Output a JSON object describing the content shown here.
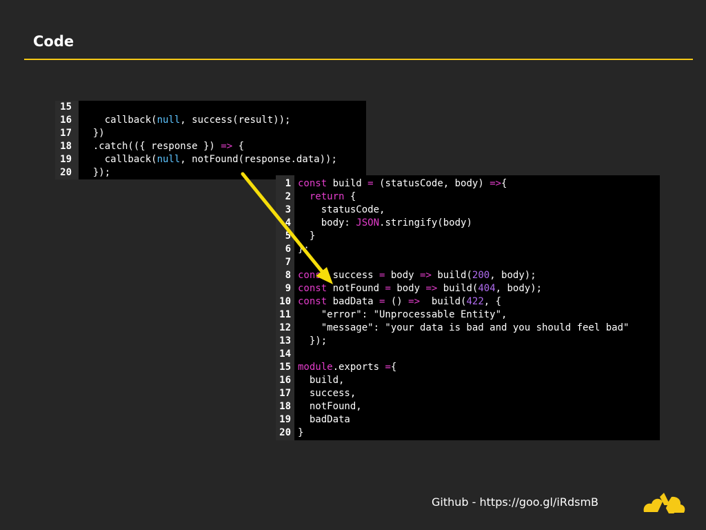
{
  "slide": {
    "title": "Code",
    "footer_link": "Github - https://goo.gl/iRdsmB"
  },
  "colors": {
    "background": "#262626",
    "accent": "#f6c915",
    "code_bg": "#000000",
    "gutter_bg": "#2c2c2c",
    "keyword": "#e33dcb",
    "null": "#5ec4ff",
    "number": "#b06cf0",
    "text": "#ffffff"
  },
  "icons": {
    "arrow": "arrow-icon",
    "logo": "logo-icon"
  },
  "snippet_a": {
    "lines": [
      {
        "n": "15",
        "tokens": []
      },
      {
        "n": "16",
        "tokens": [
          {
            "t": "    callback(",
            "c": "plain"
          },
          {
            "t": "null",
            "c": "null"
          },
          {
            "t": ", success(result));",
            "c": "plain"
          }
        ]
      },
      {
        "n": "17",
        "tokens": [
          {
            "t": "  })",
            "c": "plain"
          }
        ]
      },
      {
        "n": "18",
        "tokens": [
          {
            "t": "  .catch(({ response }) ",
            "c": "plain"
          },
          {
            "t": "=>",
            "c": "kw"
          },
          {
            "t": " {",
            "c": "plain"
          }
        ]
      },
      {
        "n": "19",
        "tokens": [
          {
            "t": "    callback(",
            "c": "plain"
          },
          {
            "t": "null",
            "c": "null"
          },
          {
            "t": ", notFound(response.data));",
            "c": "plain"
          }
        ]
      },
      {
        "n": "20",
        "tokens": [
          {
            "t": "  });",
            "c": "plain"
          }
        ]
      }
    ]
  },
  "snippet_b": {
    "lines": [
      {
        "n": "1",
        "tokens": [
          {
            "t": "const",
            "c": "kw"
          },
          {
            "t": " build ",
            "c": "plain"
          },
          {
            "t": "=",
            "c": "kw"
          },
          {
            "t": " (statusCode, body) ",
            "c": "plain"
          },
          {
            "t": "=>",
            "c": "kw"
          },
          {
            "t": "{",
            "c": "plain"
          }
        ]
      },
      {
        "n": "2",
        "tokens": [
          {
            "t": "  ",
            "c": "plain"
          },
          {
            "t": "return",
            "c": "kw"
          },
          {
            "t": " {",
            "c": "plain"
          }
        ]
      },
      {
        "n": "3",
        "tokens": [
          {
            "t": "    statusCode,",
            "c": "plain"
          }
        ]
      },
      {
        "n": "4",
        "tokens": [
          {
            "t": "    body: ",
            "c": "plain"
          },
          {
            "t": "JSON",
            "c": "kw"
          },
          {
            "t": ".stringify(body)",
            "c": "plain"
          }
        ]
      },
      {
        "n": "5",
        "tokens": [
          {
            "t": "  }",
            "c": "plain"
          }
        ]
      },
      {
        "n": "6",
        "tokens": [
          {
            "t": "};",
            "c": "plain"
          }
        ]
      },
      {
        "n": "7",
        "tokens": []
      },
      {
        "n": "8",
        "tokens": [
          {
            "t": "const",
            "c": "kw"
          },
          {
            "t": " success ",
            "c": "plain"
          },
          {
            "t": "=",
            "c": "kw"
          },
          {
            "t": " body ",
            "c": "plain"
          },
          {
            "t": "=>",
            "c": "kw"
          },
          {
            "t": " build(",
            "c": "plain"
          },
          {
            "t": "200",
            "c": "num"
          },
          {
            "t": ", body);",
            "c": "plain"
          }
        ]
      },
      {
        "n": "9",
        "tokens": [
          {
            "t": "const",
            "c": "kw"
          },
          {
            "t": " notFound ",
            "c": "plain"
          },
          {
            "t": "=",
            "c": "kw"
          },
          {
            "t": " body ",
            "c": "plain"
          },
          {
            "t": "=>",
            "c": "kw"
          },
          {
            "t": " build(",
            "c": "plain"
          },
          {
            "t": "404",
            "c": "num"
          },
          {
            "t": ", body);",
            "c": "plain"
          }
        ]
      },
      {
        "n": "10",
        "tokens": [
          {
            "t": "const",
            "c": "kw"
          },
          {
            "t": " badData ",
            "c": "plain"
          },
          {
            "t": "=",
            "c": "kw"
          },
          {
            "t": " () ",
            "c": "plain"
          },
          {
            "t": "=>",
            "c": "kw"
          },
          {
            "t": "  build(",
            "c": "plain"
          },
          {
            "t": "422",
            "c": "num"
          },
          {
            "t": ", {",
            "c": "plain"
          }
        ]
      },
      {
        "n": "11",
        "tokens": [
          {
            "t": "    \"error\": \"Unprocessable Entity\",",
            "c": "str"
          }
        ]
      },
      {
        "n": "12",
        "tokens": [
          {
            "t": "    \"message\": \"your data is bad and you should feel bad\"",
            "c": "str"
          }
        ]
      },
      {
        "n": "13",
        "tokens": [
          {
            "t": "  });",
            "c": "plain"
          }
        ]
      },
      {
        "n": "14",
        "tokens": []
      },
      {
        "n": "15",
        "tokens": [
          {
            "t": "module",
            "c": "kw"
          },
          {
            "t": ".exports ",
            "c": "plain"
          },
          {
            "t": "=",
            "c": "kw"
          },
          {
            "t": "{",
            "c": "plain"
          }
        ]
      },
      {
        "n": "16",
        "tokens": [
          {
            "t": "  build,",
            "c": "plain"
          }
        ]
      },
      {
        "n": "17",
        "tokens": [
          {
            "t": "  success,",
            "c": "plain"
          }
        ]
      },
      {
        "n": "18",
        "tokens": [
          {
            "t": "  notFound,",
            "c": "plain"
          }
        ]
      },
      {
        "n": "19",
        "tokens": [
          {
            "t": "  badData",
            "c": "plain"
          }
        ]
      },
      {
        "n": "20",
        "tokens": [
          {
            "t": "}",
            "c": "plain"
          }
        ]
      }
    ]
  }
}
